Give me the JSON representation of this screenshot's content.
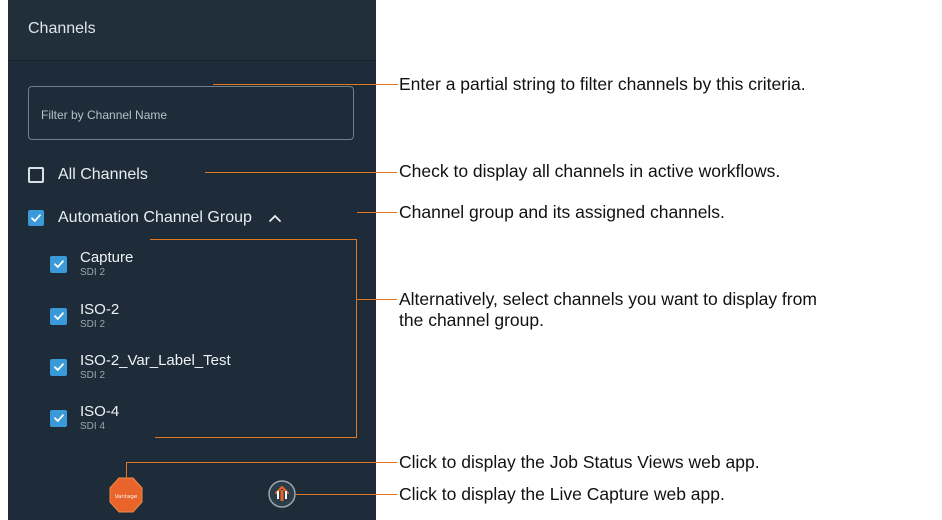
{
  "panel": {
    "title": "Channels",
    "filter": {
      "placeholder": "Filter by Channel Name"
    },
    "all_channels": {
      "label": "All Channels",
      "checked": false
    },
    "group": {
      "label": "Automation Channel Group",
      "checked": true,
      "expanded": true
    },
    "channels": [
      {
        "name": "Capture",
        "source": "SDI 2",
        "checked": true
      },
      {
        "name": "ISO-2",
        "source": "SDI 2",
        "checked": true
      },
      {
        "name": "ISO-2_Var_Label_Test",
        "source": "SDI 2",
        "checked": true
      },
      {
        "name": "ISO-4",
        "source": "SDI 4",
        "checked": true
      }
    ],
    "footer": {
      "vantage_label": "Vantage"
    }
  },
  "callouts": {
    "filter": "Enter a partial string to filter channels by this criteria.",
    "all_channels": "Check to display all channels in active workflows.",
    "group": "Channel group and its assigned channels.",
    "channels_line1": "Alternatively, select channels you want to display from",
    "channels_line2": "the channel group.",
    "vantage": "Click to display the Job Status Views web app.",
    "live_capture": "Click to display the Live Capture web app."
  },
  "colors": {
    "panel_bg": "#1d2c38",
    "checkbox_accent": "#3a9ad9",
    "callout_line": "#e4761f",
    "vantage_badge": "#e8642a"
  },
  "icons": [
    "check-icon",
    "chevron-up-icon",
    "vantage-icon",
    "live-capture-icon"
  ]
}
